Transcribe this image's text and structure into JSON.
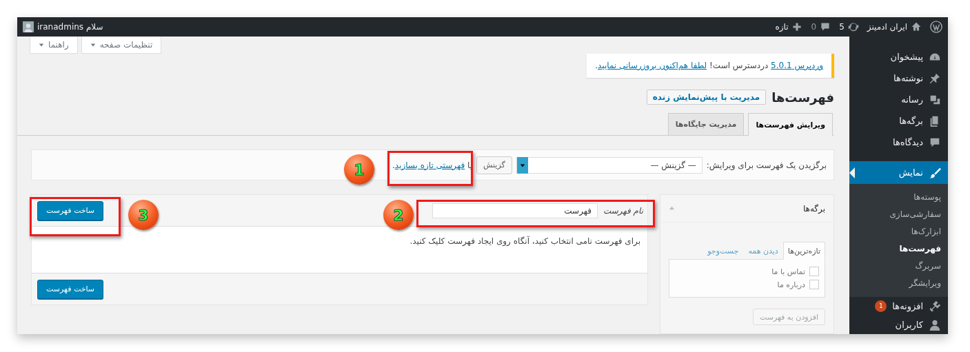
{
  "admin_bar": {
    "site_name": "ایران ادمینز",
    "updates": "5",
    "comments": "0",
    "new": "تازه",
    "greeting": "سلام iranadmins"
  },
  "screen_links": [
    {
      "label": "تنظیمات صفحه"
    },
    {
      "label": "راهنما"
    }
  ],
  "notice": {
    "version_link": "وردپرس 5.0.1",
    "text": " دردسترس است! ",
    "update_link": "لطفا هم‌اکنون بروزرسانی نمایید",
    "end": "."
  },
  "page_title": "فهرست‌ها",
  "live_preview_button": "مدیریت با پیش‌نمایش زنده",
  "tabs": [
    {
      "label": "ویرایش فهرست‌ها",
      "selected": true
    },
    {
      "label": "مدیریت جایگاه‌ها",
      "selected": false
    }
  ],
  "menu_select": {
    "label": "برگزیدن یک فهرست برای ویرایش:",
    "value": "— گزینش —",
    "button": "گزینش",
    "or": "یا ",
    "create_link": "فهرستی تازه بسازید",
    "end": "."
  },
  "pages_box": {
    "title": "برگه‌ها",
    "tabs": [
      {
        "label": "تازه‌ترین‌ها",
        "selected": true
      },
      {
        "label": "دیدن همه",
        "selected": false
      },
      {
        "label": "جست‌وجو",
        "selected": false
      }
    ],
    "items": [
      {
        "label": "تماس با ما",
        "checked": false
      },
      {
        "label": "درباره ما",
        "checked": false
      }
    ],
    "button": {
      "label": "افزودن به فهرست",
      "disabled": true
    }
  },
  "menu_editor": {
    "name_label": "نام فهرست",
    "name_value": "فهرست",
    "create_button": "ساخت فهرست",
    "instructions": "برای فهرست نامی انتخاب کنید، آنگاه روی ایجاد فهرست کلیک کنید.",
    "footer_button": "ساخت فهرست"
  },
  "sidebar": {
    "items": [
      {
        "label": "پیشخوان",
        "selected": false
      },
      {
        "label": "نوشته‌ها",
        "selected": false
      },
      {
        "label": "رسانه",
        "selected": false
      },
      {
        "label": "برگه‌ها",
        "selected": false
      },
      {
        "label": "دیدگاه‌ها",
        "selected": false
      },
      {
        "label": "نمایش",
        "selected": true,
        "children": [
          {
            "label": "پوسته‌ها",
            "selected": false
          },
          {
            "label": "سفارشی‌سازی",
            "selected": false
          },
          {
            "label": "ابزارک‌ها",
            "selected": false
          },
          {
            "label": "فهرست‌ها",
            "selected": true
          },
          {
            "label": "سربرگ",
            "selected": false
          },
          {
            "label": "ویرایشگر",
            "selected": false
          }
        ]
      },
      {
        "label": "افزونه‌ها",
        "selected": false,
        "badge": "1"
      },
      {
        "label": "کاربران",
        "selected": false
      }
    ]
  },
  "callouts": [
    {
      "number": "1"
    },
    {
      "number": "2"
    },
    {
      "number": "3"
    }
  ]
}
